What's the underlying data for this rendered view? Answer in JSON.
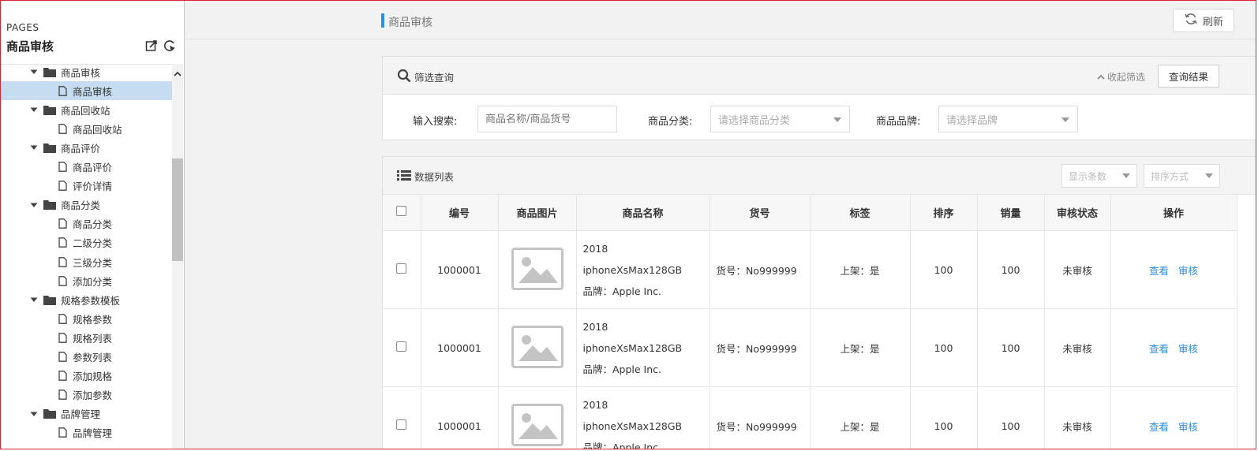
{
  "sidebar": {
    "pages_label": "PAGES",
    "title": "商品审核",
    "tree": [
      {
        "type": "folder",
        "label": "商品审核"
      },
      {
        "type": "file",
        "label": "商品审核",
        "selected": true
      },
      {
        "type": "folder",
        "label": "商品回收站"
      },
      {
        "type": "file",
        "label": "商品回收站"
      },
      {
        "type": "folder",
        "label": "商品评价"
      },
      {
        "type": "file",
        "label": "商品评价"
      },
      {
        "type": "file",
        "label": "评价详情"
      },
      {
        "type": "folder",
        "label": "商品分类"
      },
      {
        "type": "file",
        "label": "商品分类"
      },
      {
        "type": "file",
        "label": "二级分类"
      },
      {
        "type": "file",
        "label": "三级分类"
      },
      {
        "type": "file",
        "label": "添加分类"
      },
      {
        "type": "folder",
        "label": "规格参数模板"
      },
      {
        "type": "file",
        "label": "规格参数"
      },
      {
        "type": "file",
        "label": "规格列表"
      },
      {
        "type": "file",
        "label": "参数列表"
      },
      {
        "type": "file",
        "label": "添加规格"
      },
      {
        "type": "file",
        "label": "添加参数"
      },
      {
        "type": "folder",
        "label": "品牌管理"
      },
      {
        "type": "file",
        "label": "品牌管理"
      }
    ]
  },
  "topbar": {
    "breadcrumb": "商品审核",
    "refresh_label": "刷新"
  },
  "filter": {
    "title": "筛选查询",
    "collapse_label": "收起筛选",
    "query_label": "查询结果",
    "search_label": "输入搜索:",
    "search_placeholder": "商品名称/商品货号",
    "category_label": "商品分类:",
    "category_placeholder": "请选择商品分类",
    "brand_label": "商品品牌:",
    "brand_placeholder": "请选择品牌"
  },
  "list": {
    "title": "数据列表",
    "page_size_placeholder": "显示条数",
    "sort_placeholder": "排序方式",
    "columns": [
      "编号",
      "商品图片",
      "商品名称",
      "货号",
      "标签",
      "排序",
      "销量",
      "审核状态",
      "操作"
    ],
    "rows": [
      {
        "id": "1000001",
        "name": "2018 iphoneXsMax128GB",
        "brand": "品牌：Apple Inc.",
        "code": "货号：No999999",
        "tag": "上架：是",
        "sort": "100",
        "sales": "100",
        "status": "未审核",
        "view": "查看",
        "audit": "审核"
      },
      {
        "id": "1000001",
        "name": "2018 iphoneXsMax128GB",
        "brand": "品牌：Apple Inc.",
        "code": "货号：No999999",
        "tag": "上架：是",
        "sort": "100",
        "sales": "100",
        "status": "未审核",
        "view": "查看",
        "audit": "审核"
      },
      {
        "id": "1000001",
        "name": "2018 iphoneXsMax128GB",
        "brand": "品牌：Apple Inc.",
        "code": "货号：No999999",
        "tag": "上架：是",
        "sort": "100",
        "sales": "100",
        "status": "未审核",
        "view": "查看",
        "audit": "审核"
      }
    ]
  },
  "colors": {
    "accent": "#2b91e0",
    "border": "#d9232e",
    "selected": "#c6ddf1"
  }
}
